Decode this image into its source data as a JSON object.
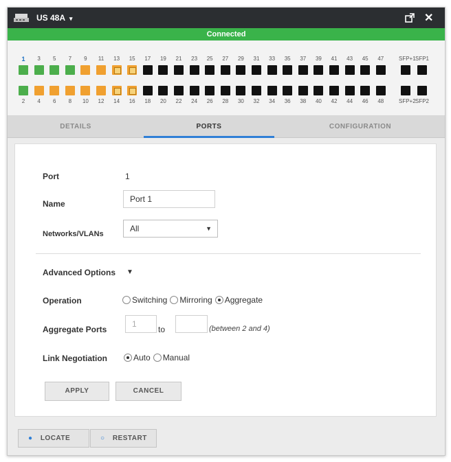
{
  "window": {
    "device_name": "US 48A",
    "dropdown_caret": "▾",
    "popout_icon": "popout-icon",
    "close_icon": "✕",
    "status": "Connected",
    "status_color": "#3ab34a"
  },
  "ports": {
    "top_numbers": [
      "1",
      "3",
      "5",
      "7",
      "9",
      "11",
      "13",
      "15",
      "17",
      "19",
      "21",
      "23",
      "25",
      "27",
      "29",
      "31",
      "33",
      "35",
      "37",
      "39",
      "41",
      "43",
      "45",
      "47"
    ],
    "bottom_numbers": [
      "2",
      "4",
      "6",
      "8",
      "10",
      "12",
      "14",
      "16",
      "18",
      "20",
      "22",
      "24",
      "26",
      "28",
      "30",
      "32",
      "34",
      "36",
      "38",
      "40",
      "42",
      "44",
      "46",
      "48"
    ],
    "sfp_top_labels": [
      "SFP+1",
      "SFP1"
    ],
    "sfp_bottom_labels": [
      "SFP+2",
      "SFP2"
    ],
    "top_states": [
      "up",
      "up",
      "up",
      "up",
      "warn",
      "warn",
      "warn-inner",
      "warn-inner",
      "off",
      "off",
      "off",
      "off",
      "off",
      "off",
      "off",
      "off",
      "off",
      "off",
      "off",
      "off",
      "off",
      "off",
      "off",
      "off"
    ],
    "bottom_states": [
      "up",
      "warn",
      "warn",
      "warn",
      "warn",
      "warn",
      "warn-inner",
      "warn-inner",
      "off",
      "off",
      "off",
      "off",
      "off",
      "off",
      "off",
      "off",
      "off",
      "off",
      "off",
      "off",
      "off",
      "off",
      "off",
      "off"
    ],
    "selected_port": "1",
    "colors": {
      "up": "#4cae4c",
      "warn": "#f0a030",
      "off": "#111111"
    }
  },
  "tabs": [
    {
      "label": "DETAILS",
      "active": false
    },
    {
      "label": "PORTS",
      "active": true
    },
    {
      "label": "CONFIGURATION",
      "active": false
    }
  ],
  "form": {
    "port_label": "Port",
    "port_value": "1",
    "name_label": "Name",
    "name_value": "Port 1",
    "networks_label": "Networks/VLANs",
    "networks_value": "All",
    "advanced_label": "Advanced Options",
    "operation_label": "Operation",
    "operation_options": [
      "Switching",
      "Mirroring",
      "Aggregate"
    ],
    "operation_selected": "Aggregate",
    "aggregate_label": "Aggregate Ports",
    "aggregate_from": "1",
    "aggregate_to_word": "to",
    "aggregate_to": "",
    "aggregate_hint": "(between 2 and 4)",
    "link_label": "Link Negotiation",
    "link_options": [
      "Auto",
      "Manual"
    ],
    "link_selected": "Auto",
    "apply_label": "APPLY",
    "cancel_label": "CANCEL"
  },
  "footer": {
    "locate_label": "LOCATE",
    "restart_label": "RESTART"
  }
}
